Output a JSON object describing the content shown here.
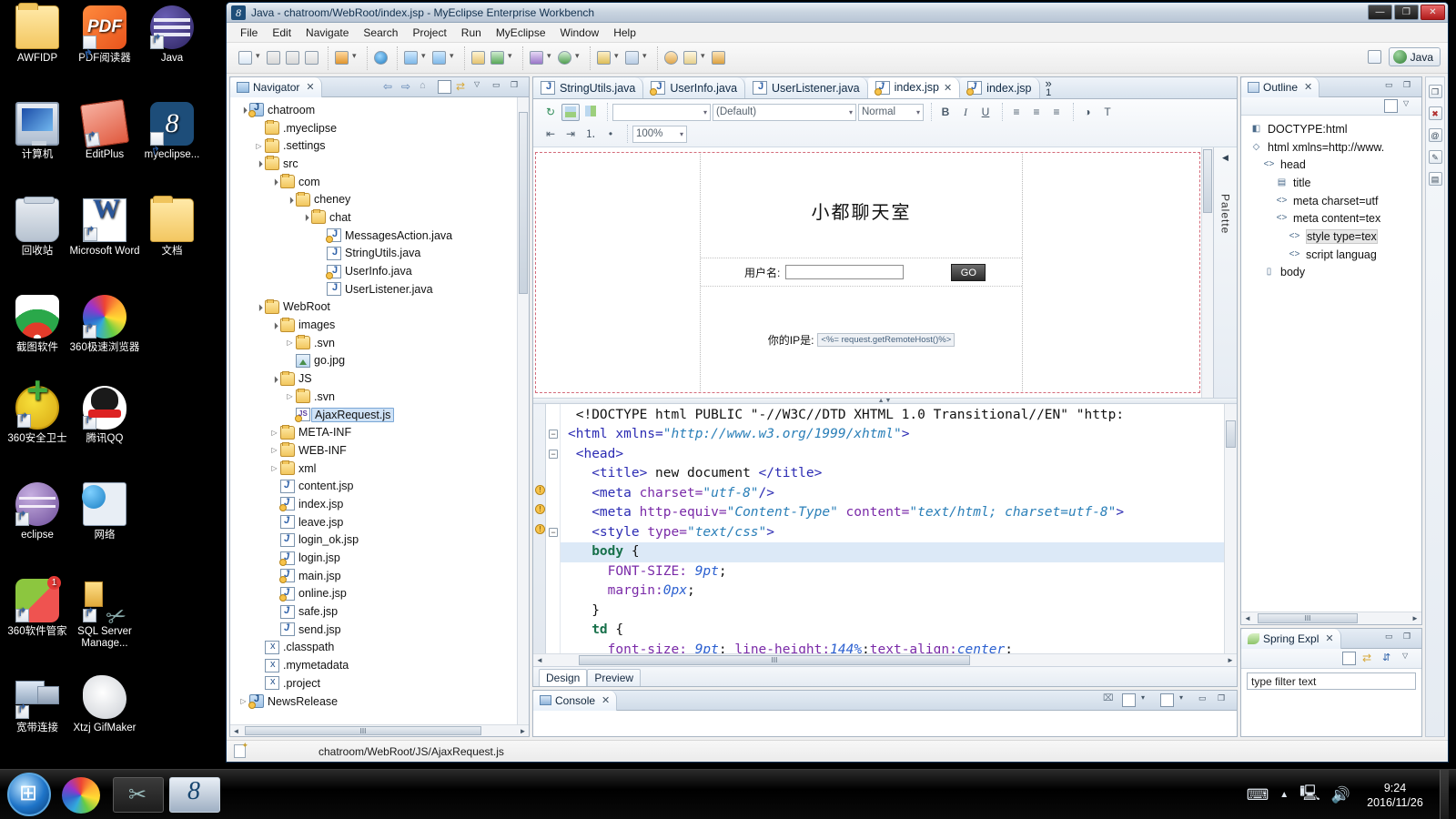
{
  "window": {
    "title": "Java - chatroom/WebRoot/index.jsp - MyEclipse Enterprise Workbench",
    "app_icon": "myeclipse-icon",
    "minimize": "—",
    "maximize": "❐",
    "close": "✕"
  },
  "menubar": {
    "items": [
      "File",
      "Edit",
      "Navigate",
      "Search",
      "Project",
      "Run",
      "MyEclipse",
      "Window",
      "Help"
    ]
  },
  "toolbar": {
    "perspective_label": "Java"
  },
  "navigator": {
    "title": "Navigator",
    "close_glyph": "✕",
    "tree": [
      {
        "label": "chatroom",
        "depth": 0,
        "arrow": "open",
        "icon": "project-icon",
        "warn": true,
        "selected": false
      },
      {
        "label": ".myeclipse",
        "depth": 1,
        "arrow": "none",
        "icon": "folder-icon",
        "warn": false,
        "selected": false
      },
      {
        "label": ".settings",
        "depth": 1,
        "arrow": "closed",
        "icon": "folder-icon",
        "warn": false,
        "selected": false
      },
      {
        "label": "src",
        "depth": 1,
        "arrow": "open",
        "icon": "source-folder-icon",
        "warn": false,
        "selected": false
      },
      {
        "label": "com",
        "depth": 2,
        "arrow": "open",
        "icon": "package-icon",
        "warn": false,
        "selected": false
      },
      {
        "label": "cheney",
        "depth": 3,
        "arrow": "open",
        "icon": "package-icon",
        "warn": false,
        "selected": false
      },
      {
        "label": "chat",
        "depth": 4,
        "arrow": "open",
        "icon": "package-icon",
        "warn": false,
        "selected": false
      },
      {
        "label": "MessagesAction.java",
        "depth": 5,
        "arrow": "none",
        "icon": "java-file-icon",
        "warn": true,
        "selected": false
      },
      {
        "label": "StringUtils.java",
        "depth": 5,
        "arrow": "none",
        "icon": "java-file-icon",
        "warn": false,
        "selected": false
      },
      {
        "label": "UserInfo.java",
        "depth": 5,
        "arrow": "none",
        "icon": "java-file-icon",
        "warn": true,
        "selected": false
      },
      {
        "label": "UserListener.java",
        "depth": 5,
        "arrow": "none",
        "icon": "java-file-icon",
        "warn": false,
        "selected": false
      },
      {
        "label": "WebRoot",
        "depth": 1,
        "arrow": "open",
        "icon": "source-folder-icon",
        "warn": false,
        "selected": false
      },
      {
        "label": "images",
        "depth": 2,
        "arrow": "open",
        "icon": "folder-icon",
        "warn": false,
        "selected": false
      },
      {
        "label": ".svn",
        "depth": 3,
        "arrow": "closed",
        "icon": "folder-icon",
        "warn": false,
        "selected": false
      },
      {
        "label": "go.jpg",
        "depth": 3,
        "arrow": "none",
        "icon": "image-file-icon",
        "warn": false,
        "selected": false
      },
      {
        "label": "JS",
        "depth": 2,
        "arrow": "open",
        "icon": "source-folder-icon",
        "warn": false,
        "selected": false
      },
      {
        "label": ".svn",
        "depth": 3,
        "arrow": "closed",
        "icon": "folder-icon",
        "warn": false,
        "selected": false
      },
      {
        "label": "AjaxRequest.js",
        "depth": 3,
        "arrow": "none",
        "icon": "js-file-icon",
        "warn": true,
        "selected": true
      },
      {
        "label": "META-INF",
        "depth": 2,
        "arrow": "closed",
        "icon": "folder-icon",
        "warn": false,
        "selected": false
      },
      {
        "label": "WEB-INF",
        "depth": 2,
        "arrow": "closed",
        "icon": "folder-icon",
        "warn": false,
        "selected": false
      },
      {
        "label": "xml",
        "depth": 2,
        "arrow": "closed",
        "icon": "folder-icon",
        "warn": false,
        "selected": false
      },
      {
        "label": "content.jsp",
        "depth": 2,
        "arrow": "none",
        "icon": "jsp-file-icon",
        "warn": false,
        "selected": false
      },
      {
        "label": "index.jsp",
        "depth": 2,
        "arrow": "none",
        "icon": "jsp-file-icon",
        "warn": true,
        "selected": false
      },
      {
        "label": "leave.jsp",
        "depth": 2,
        "arrow": "none",
        "icon": "jsp-file-icon",
        "warn": false,
        "selected": false
      },
      {
        "label": "login_ok.jsp",
        "depth": 2,
        "arrow": "none",
        "icon": "jsp-file-icon",
        "warn": false,
        "selected": false
      },
      {
        "label": "login.jsp",
        "depth": 2,
        "arrow": "none",
        "icon": "jsp-file-icon",
        "warn": true,
        "selected": false
      },
      {
        "label": "main.jsp",
        "depth": 2,
        "arrow": "none",
        "icon": "jsp-file-icon",
        "warn": true,
        "selected": false
      },
      {
        "label": "online.jsp",
        "depth": 2,
        "arrow": "none",
        "icon": "jsp-file-icon",
        "warn": true,
        "selected": false
      },
      {
        "label": "safe.jsp",
        "depth": 2,
        "arrow": "none",
        "icon": "jsp-file-icon",
        "warn": false,
        "selected": false
      },
      {
        "label": "send.jsp",
        "depth": 2,
        "arrow": "none",
        "icon": "jsp-file-icon",
        "warn": false,
        "selected": false
      },
      {
        "label": ".classpath",
        "depth": 1,
        "arrow": "none",
        "icon": "xml-file-icon",
        "warn": false,
        "selected": false
      },
      {
        "label": ".mymetadata",
        "depth": 1,
        "arrow": "none",
        "icon": "xml-file-icon",
        "warn": false,
        "selected": false
      },
      {
        "label": ".project",
        "depth": 1,
        "arrow": "none",
        "icon": "xml-file-icon",
        "warn": false,
        "selected": false
      },
      {
        "label": "NewsRelease",
        "depth": 0,
        "arrow": "closed",
        "icon": "project-icon",
        "warn": true,
        "selected": false
      }
    ]
  },
  "editor": {
    "tabs": [
      {
        "label": "StringUtils.java",
        "icon": "java-file-icon",
        "warn": false,
        "active": false,
        "closable": false
      },
      {
        "label": "UserInfo.java",
        "icon": "java-file-icon",
        "warn": true,
        "active": false,
        "closable": false
      },
      {
        "label": "UserListener.java",
        "icon": "java-file-icon",
        "warn": false,
        "active": false,
        "closable": false
      },
      {
        "label": "index.jsp",
        "icon": "jsp-file-icon",
        "warn": true,
        "active": true,
        "closable": true
      },
      {
        "label": "index.jsp",
        "icon": "jsp-file-icon",
        "warn": true,
        "active": false,
        "closable": false
      }
    ],
    "overflow_chevron": "»",
    "overflow_count": "1",
    "close_glyph": "✕",
    "format_toolbar": {
      "style_combo_value": "",
      "font_combo_value": "(Default)",
      "format_combo_value": "Normal",
      "zoom_value": "100%",
      "bold": "B",
      "italic": "I",
      "underline": "U"
    },
    "design": {
      "chat_title": "小都聊天室",
      "username_label": "用户名:",
      "username_value": "",
      "go_button": "GO",
      "ip_label": "你的IP是:",
      "ip_expression": "<%= request.getRemoteHost()%>"
    },
    "source_lines": [
      {
        "highlight": false,
        "warn": false,
        "fold": "none",
        "segments": [
          {
            "t": " <!DOCTYPE html PUBLIC ",
            "c": "c-dt"
          },
          {
            "t": "\"-//W3C//DTD XHTML 1.0 Transitional//EN\"",
            "c": "c-dt"
          },
          {
            "t": " \"http:",
            "c": "c-dt"
          }
        ]
      },
      {
        "highlight": false,
        "warn": false,
        "fold": "minus",
        "segments": [
          {
            "t": "<html ",
            "c": "c-tag"
          },
          {
            "t": "xmlns=",
            "c": "c-tag"
          },
          {
            "t": "\"http://www.w3.org/1999/xhtml\"",
            "c": "c-str"
          },
          {
            "t": ">",
            "c": "c-tag"
          }
        ]
      },
      {
        "highlight": false,
        "warn": false,
        "fold": "minus",
        "segments": [
          {
            "t": " <head>",
            "c": "c-tag"
          }
        ]
      },
      {
        "highlight": false,
        "warn": false,
        "fold": "none",
        "segments": [
          {
            "t": "   <title>",
            "c": "c-tag"
          },
          {
            "t": " new document ",
            "c": "c-txt"
          },
          {
            "t": "</title>",
            "c": "c-tag"
          }
        ]
      },
      {
        "highlight": false,
        "warn": true,
        "fold": "none",
        "segments": [
          {
            "t": "   <meta ",
            "c": "c-tag"
          },
          {
            "t": "charset=",
            "c": "c-attr"
          },
          {
            "t": "\"utf-8\"",
            "c": "c-str"
          },
          {
            "t": "/>",
            "c": "c-tag"
          }
        ]
      },
      {
        "highlight": false,
        "warn": true,
        "fold": "none",
        "segments": [
          {
            "t": "   <meta ",
            "c": "c-tag"
          },
          {
            "t": "http-equiv=",
            "c": "c-attr"
          },
          {
            "t": "\"Content-Type\"",
            "c": "c-str"
          },
          {
            "t": " content=",
            "c": "c-attr"
          },
          {
            "t": "\"text/html; charset=utf-8\"",
            "c": "c-str"
          },
          {
            "t": ">",
            "c": "c-tag"
          }
        ]
      },
      {
        "highlight": false,
        "warn": true,
        "fold": "minus",
        "segments": [
          {
            "t": "   <style ",
            "c": "c-tag"
          },
          {
            "t": "type=",
            "c": "c-attr"
          },
          {
            "t": "\"text/css\"",
            "c": "c-str"
          },
          {
            "t": ">",
            "c": "c-tag"
          }
        ]
      },
      {
        "highlight": true,
        "warn": false,
        "fold": "none",
        "segments": [
          {
            "t": "   body ",
            "c": "c-sel"
          },
          {
            "t": "{",
            "c": "c-pun"
          }
        ]
      },
      {
        "highlight": false,
        "warn": false,
        "fold": "none",
        "segments": [
          {
            "t": "     FONT-SIZE: ",
            "c": "c-prop"
          },
          {
            "t": "9pt",
            "c": "c-val"
          },
          {
            "t": ";",
            "c": "c-pun"
          }
        ]
      },
      {
        "highlight": false,
        "warn": false,
        "fold": "none",
        "segments": [
          {
            "t": "     margin:",
            "c": "c-prop"
          },
          {
            "t": "0px",
            "c": "c-val"
          },
          {
            "t": ";",
            "c": "c-pun"
          }
        ]
      },
      {
        "highlight": false,
        "warn": false,
        "fold": "none",
        "segments": [
          {
            "t": "   }",
            "c": "c-pun"
          }
        ]
      },
      {
        "highlight": false,
        "warn": false,
        "fold": "none",
        "segments": [
          {
            "t": "   td ",
            "c": "c-sel"
          },
          {
            "t": "{",
            "c": "c-pun"
          }
        ]
      },
      {
        "highlight": false,
        "warn": false,
        "fold": "none",
        "segments": [
          {
            "t": "     font-size: ",
            "c": "c-prop"
          },
          {
            "t": "9pt",
            "c": "c-val"
          },
          {
            "t": "; ",
            "c": "c-pun"
          },
          {
            "t": "line-height:",
            "c": "c-prop"
          },
          {
            "t": "144%",
            "c": "c-val"
          },
          {
            "t": ";",
            "c": "c-pun"
          },
          {
            "t": "text-align:",
            "c": "c-prop"
          },
          {
            "t": "center",
            "c": "c-val"
          },
          {
            "t": ";",
            "c": "c-pun"
          }
        ]
      }
    ],
    "bottom_tabs": [
      {
        "label": "Design",
        "active": true
      },
      {
        "label": "Preview",
        "active": false
      }
    ],
    "palette_label": "Palette"
  },
  "console": {
    "title": "Console",
    "close_glyph": "✕"
  },
  "outline": {
    "title": "Outline",
    "close_glyph": "✕",
    "nodes": [
      {
        "label": "DOCTYPE:html",
        "depth": 0,
        "icon": "doctype-icon",
        "selected": false
      },
      {
        "label": "html xmlns=http://www.",
        "depth": 0,
        "icon": "element-icon",
        "selected": false
      },
      {
        "label": "head",
        "depth": 1,
        "icon": "tag-icon",
        "selected": false
      },
      {
        "label": "title",
        "depth": 2,
        "icon": "title-icon",
        "selected": false
      },
      {
        "label": "meta charset=utf",
        "depth": 2,
        "icon": "tag-icon",
        "selected": false
      },
      {
        "label": "meta content=tex",
        "depth": 2,
        "icon": "tag-icon",
        "selected": false
      },
      {
        "label": "style type=tex",
        "depth": 3,
        "icon": "tag-icon",
        "selected": true
      },
      {
        "label": "script languag",
        "depth": 3,
        "icon": "tag-icon",
        "selected": false
      },
      {
        "label": "body",
        "depth": 1,
        "icon": "body-icon",
        "selected": false
      }
    ]
  },
  "spring_explorer": {
    "title": "Spring Expl",
    "close_glyph": "✕",
    "filter_placeholder": "type filter text"
  },
  "statusbar": {
    "path": "chatroom/WebRoot/JS/AjaxRequest.js"
  },
  "desktop": {
    "icons": [
      {
        "label": "AWFIDP",
        "art": "ic-folder",
        "shortcut": false
      },
      {
        "label": "PDF阅读器",
        "art": "ic-pdf",
        "shortcut": true,
        "text": "PDF"
      },
      {
        "label": "Java",
        "art": "ic-java",
        "shortcut": true
      },
      {
        "label": "计算机",
        "art": "ic-pc",
        "shortcut": false
      },
      {
        "label": "EditPlus",
        "art": "ic-editplus",
        "shortcut": true
      },
      {
        "label": "myeclipse...",
        "art": "ic-myecl",
        "shortcut": true,
        "text": "8"
      },
      {
        "label": "回收站",
        "art": "ic-bin",
        "shortcut": false
      },
      {
        "label": "Microsoft Word",
        "art": "ic-word",
        "shortcut": true
      },
      {
        "label": "文档",
        "art": "ic-folder",
        "shortcut": false
      },
      {
        "label": "截图软件",
        "art": "ic-shot",
        "shortcut": false
      },
      {
        "label": "360极速浏览器",
        "art": "ic-360",
        "shortcut": true
      },
      {
        "label": "",
        "art": "",
        "shortcut": false
      },
      {
        "label": "360安全卫士",
        "art": "ic-360s",
        "shortcut": true
      },
      {
        "label": "腾讯QQ",
        "art": "ic-qq",
        "shortcut": true
      },
      {
        "label": "",
        "art": "",
        "shortcut": false
      },
      {
        "label": "eclipse",
        "art": "ic-eclipse",
        "shortcut": true
      },
      {
        "label": "网络",
        "art": "ic-net",
        "shortcut": false
      },
      {
        "label": "",
        "art": "",
        "shortcut": false
      },
      {
        "label": "360软件管家",
        "art": "ic-360m",
        "shortcut": true
      },
      {
        "label": "SQL Server Manage...",
        "art": "ic-sql",
        "shortcut": true
      },
      {
        "label": "",
        "art": "",
        "shortcut": false
      },
      {
        "label": "宽带连接",
        "art": "ic-bb",
        "shortcut": true
      },
      {
        "label": "Xtzj GifMaker",
        "art": "ic-gif",
        "shortcut": false
      },
      {
        "label": "",
        "art": "",
        "shortcut": false
      }
    ]
  },
  "taskbar": {
    "start_label": "start-orb",
    "items": [
      "360-browser-task",
      "sql-server-task",
      "myeclipse-task"
    ],
    "tray_icons": [
      "keyboard-icon",
      "show-hidden-icon",
      "network-icon",
      "volume-icon"
    ],
    "clock_time": "9:24",
    "clock_date": "2016/11/26"
  }
}
